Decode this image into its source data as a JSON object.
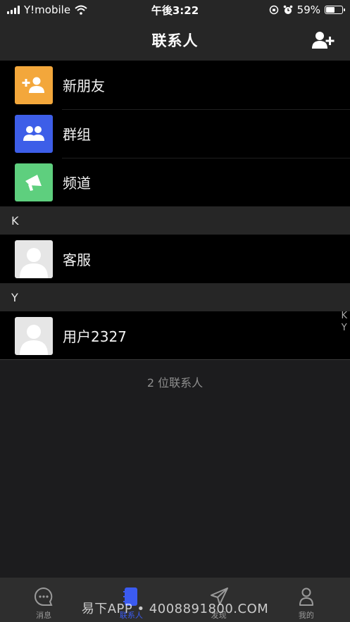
{
  "status": {
    "carrier": "Y!mobile",
    "time": "午後3:22",
    "battery": "59%",
    "battery_level": 0.59
  },
  "header": {
    "title": "联系人"
  },
  "functions": [
    {
      "label": "新朋友",
      "icon": "add-friend-icon",
      "color": "#f3a73b"
    },
    {
      "label": "群组",
      "icon": "group-icon",
      "color": "#3d5ee8"
    },
    {
      "label": "频道",
      "icon": "megaphone-icon",
      "color": "#5ecf7e"
    }
  ],
  "sections": [
    {
      "letter": "K",
      "contacts": [
        {
          "name": "客服"
        }
      ]
    },
    {
      "letter": "Y",
      "contacts": [
        {
          "name": "用户2327"
        }
      ]
    }
  ],
  "footer": {
    "count_text": "2 位联系人"
  },
  "index": [
    "K",
    "Y"
  ],
  "tabs": [
    {
      "label": "消息",
      "icon": "chat-bubble-icon"
    },
    {
      "label": "联系人",
      "icon": "contacts-book-icon",
      "active": true
    },
    {
      "label": "发现",
      "icon": "paper-plane-icon"
    },
    {
      "label": "我的",
      "icon": "person-icon"
    }
  ],
  "watermark": "易下APP • 4008891800.COM",
  "colors": {
    "accent": "#3b5bf0",
    "list_bg": "#000000",
    "header_bg": "#262626"
  }
}
